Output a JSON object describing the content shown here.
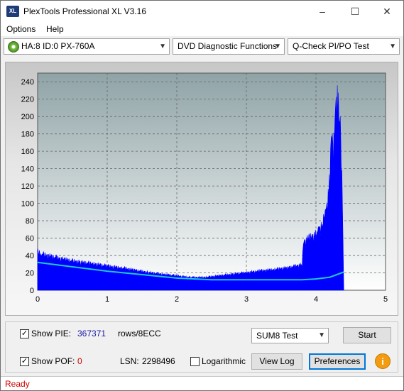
{
  "window": {
    "title": "PlexTools Professional XL V3.16",
    "icon_label": "XL"
  },
  "menu": {
    "options": "Options",
    "help": "Help"
  },
  "toolbar": {
    "drive": "HA:8 ID:0  PX-760A",
    "function": "DVD Diagnostic Functions",
    "test": "Q-Check PI/PO Test"
  },
  "chart_data": {
    "type": "area",
    "xlim": [
      0,
      5
    ],
    "ylim": [
      0,
      250
    ],
    "x_ticks": [
      "0",
      "1",
      "2",
      "3",
      "4",
      "5"
    ],
    "y_ticks": [
      "0",
      "20",
      "40",
      "60",
      "80",
      "100",
      "120",
      "140",
      "160",
      "180",
      "200",
      "220",
      "240"
    ],
    "grid": true,
    "series": [
      {
        "color": "#0000ff",
        "x": [
          0.0,
          0.05,
          0.2,
          0.4,
          0.6,
          0.8,
          1.0,
          1.2,
          1.4,
          1.6,
          1.8,
          2.0,
          2.2,
          2.4,
          2.6,
          2.8,
          3.0,
          3.2,
          3.4,
          3.6,
          3.8,
          3.82,
          3.9,
          4.0,
          4.05,
          4.1,
          4.15,
          4.2,
          4.22,
          4.25,
          4.28,
          4.3,
          4.33,
          4.35,
          4.38,
          4.4
        ],
        "y": [
          48,
          45,
          42,
          38,
          35,
          33,
          30,
          28,
          25,
          22,
          20,
          18,
          16,
          16,
          18,
          20,
          22,
          24,
          26,
          28,
          32,
          60,
          65,
          70,
          75,
          85,
          100,
          140,
          190,
          170,
          230,
          250,
          220,
          200,
          120,
          0
        ]
      },
      {
        "color": "#20c8d8",
        "x": [
          0.0,
          0.5,
          1.0,
          1.5,
          2.0,
          2.5,
          3.0,
          3.5,
          3.8,
          4.0,
          4.2,
          4.3,
          4.4
        ],
        "y": [
          32,
          27,
          22,
          18,
          14,
          12,
          12,
          12,
          12,
          13,
          15,
          18,
          21
        ]
      }
    ]
  },
  "stats": {
    "show_pie_label": "Show PIE:",
    "pie_value": "367371",
    "pie_unit": "rows/8ECC",
    "show_pof_label": "Show POF:",
    "pof_value": "0",
    "lsn_label": "LSN:",
    "lsn_value": "2298496",
    "logarithmic_label": "Logarithmic"
  },
  "controls": {
    "test_mode": "SUM8 Test",
    "start": "Start",
    "view_log": "View Log",
    "preferences": "Preferences",
    "info": "i"
  },
  "status": {
    "text": "Ready"
  }
}
